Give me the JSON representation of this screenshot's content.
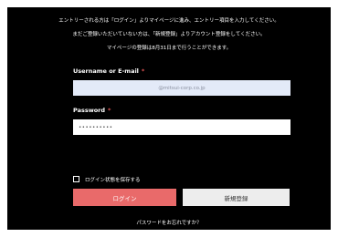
{
  "intro": {
    "line1": "エントリーされる方は「ログイン」よりマイページに進み、エントリー項目を入力してください。",
    "line2": "まだご登録いただいていない方は、「新規登録」よりアカウント登録をしてください。",
    "line3": "マイページの登録は8月31日まで行うことができます。"
  },
  "email": {
    "label": "Username or E-mail",
    "required_mark": "*",
    "value": "@mitsui-corp.co.jp"
  },
  "password": {
    "label": "Password",
    "required_mark": "*",
    "value": "••••••••••"
  },
  "remember": {
    "label": "ログイン状態を保存する",
    "checked": false
  },
  "buttons": {
    "login": "ログイン",
    "signup": "新規登録"
  },
  "forgot_link": "パスワードをお忘れですか？",
  "colors": {
    "panel": "#000000",
    "login_button": "#e96a6a",
    "signup_button": "#ededed",
    "email_field": "#e3eaf8",
    "required": "#e05555"
  }
}
